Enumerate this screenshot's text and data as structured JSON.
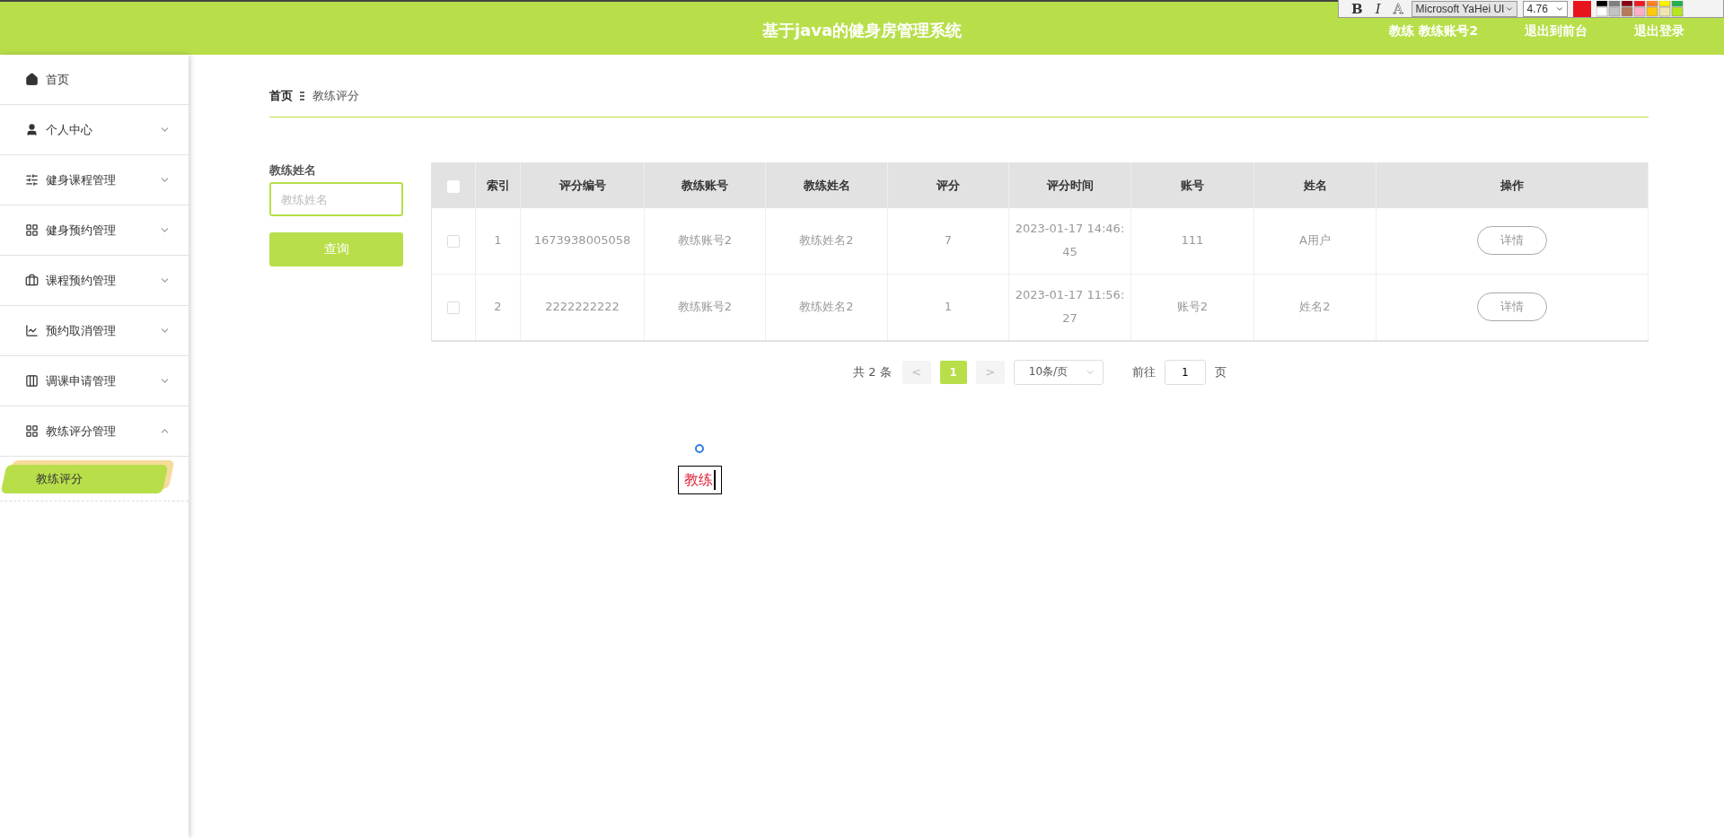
{
  "header": {
    "title": "基于java的健身房管理系统",
    "user": "教练 教练账号2",
    "links": [
      "退出到前台",
      "退出登录"
    ]
  },
  "sidebar": {
    "items": [
      {
        "label": "首页",
        "kind": "link"
      },
      {
        "label": "个人中心",
        "kind": "menu",
        "expanded": false
      },
      {
        "label": "健身课程管理",
        "kind": "menu",
        "expanded": false
      },
      {
        "label": "健身预约管理",
        "kind": "menu",
        "expanded": false
      },
      {
        "label": "课程预约管理",
        "kind": "menu",
        "expanded": false
      },
      {
        "label": "预约取消管理",
        "kind": "menu",
        "expanded": false
      },
      {
        "label": "调课申请管理",
        "kind": "menu",
        "expanded": false
      },
      {
        "label": "教练评分管理",
        "kind": "menu",
        "expanded": true,
        "children": [
          {
            "label": "教练评分",
            "selected": true
          }
        ]
      }
    ]
  },
  "breadcrumb": [
    "首页",
    "教练评分"
  ],
  "search": {
    "label": "教练姓名",
    "placeholder": "教练姓名",
    "button": "查询"
  },
  "table": {
    "header_checked": false,
    "columns": [
      "索引",
      "评分编号",
      "教练账号",
      "教练姓名",
      "评分",
      "评分时间",
      "账号",
      "姓名",
      "操作"
    ],
    "rows": [
      {
        "checked": false,
        "cells": [
          "1",
          "1673938005058",
          "教练账号2",
          "教练姓名2",
          "7",
          "2023-01-17 14:46:45",
          "111",
          "A用户"
        ],
        "action": "详情"
      },
      {
        "checked": false,
        "cells": [
          "2",
          "2222222222",
          "教练账号2",
          "教练姓名2",
          "1",
          "2023-01-17 11:56:27",
          "账号2",
          "姓名2"
        ],
        "action": "详情"
      }
    ]
  },
  "pagination": {
    "total": "共 2 条",
    "prev": "<",
    "pages": [
      {
        "label": "1",
        "selected": true
      }
    ],
    "next": ">",
    "page_size": "10条/页",
    "goto_label": "前往",
    "goto_value": "1",
    "goto_suffix": "页"
  },
  "text_box": {
    "text": "教练"
  },
  "format_toolbar": {
    "bold": "B",
    "italic": "I",
    "outline": "A",
    "font": "Microsoft YaHei UI",
    "size": "4.76",
    "color": "#e8141c"
  }
}
